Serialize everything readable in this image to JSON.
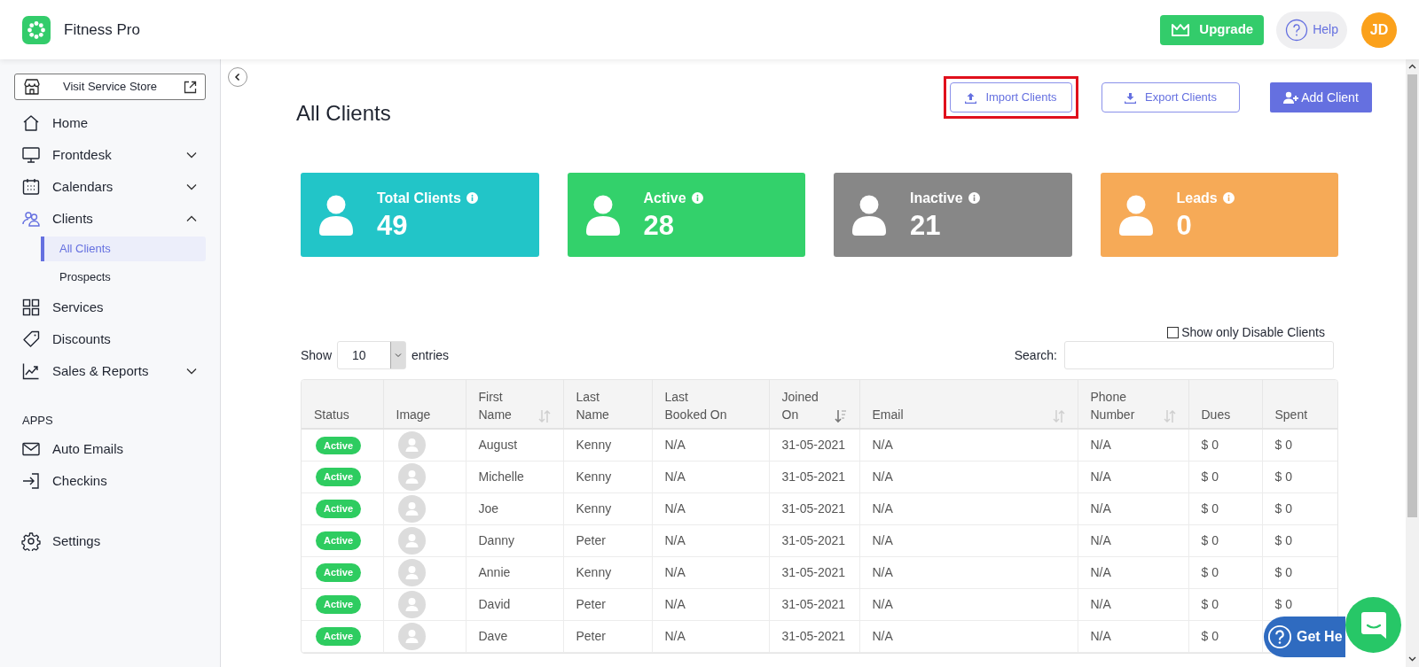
{
  "header": {
    "app_name": "Fitness Pro",
    "upgrade_label": "Upgrade",
    "help_label": "Help",
    "avatar_initials": "JD"
  },
  "sidebar": {
    "store_button": "Visit Service Store",
    "items": [
      {
        "label": "Home",
        "selected": false
      },
      {
        "label": "Frontdesk",
        "selected": false,
        "expanded": false
      },
      {
        "label": "Calendars",
        "selected": false,
        "expanded": false
      },
      {
        "label": "Clients",
        "selected": false,
        "expanded": true,
        "children": [
          {
            "label": "All Clients",
            "selected": true
          },
          {
            "label": "Prospects",
            "selected": false
          }
        ]
      },
      {
        "label": "Services",
        "selected": false
      },
      {
        "label": "Discounts",
        "selected": false
      },
      {
        "label": "Sales & Reports",
        "selected": false,
        "expanded": false
      }
    ],
    "apps_label": "APPS",
    "apps": [
      {
        "label": "Auto Emails",
        "selected": false
      },
      {
        "label": "Checkins",
        "selected": false
      }
    ],
    "footer_items": [
      {
        "label": "Settings",
        "selected": false
      }
    ]
  },
  "page": {
    "title": "All Clients",
    "buttons": [
      {
        "label": "Import Clients",
        "kind": "outline",
        "highlighted": true
      },
      {
        "label": "Export Clients",
        "kind": "outline",
        "highlighted": false
      },
      {
        "label": "Add Client",
        "kind": "primary",
        "highlighted": false
      }
    ],
    "stats": [
      {
        "label": "Total Clients",
        "value": "49",
        "color": "#22c5c8"
      },
      {
        "label": "Active",
        "value": "28",
        "color": "#33d16b"
      },
      {
        "label": "Inactive",
        "value": "21",
        "color": "#878787"
      },
      {
        "label": "Leads",
        "value": "0",
        "color": "#f6aa57"
      }
    ]
  },
  "filter": {
    "label": "Show only Disable Clients",
    "checked": false
  },
  "table_controls": {
    "show_label": "Show",
    "page_size": "10",
    "entries_label": "entries",
    "search_label": "Search:"
  },
  "table": {
    "columns": [
      {
        "label": "Status"
      },
      {
        "label": "Image"
      },
      {
        "label": "First\nName",
        "sortable": true
      },
      {
        "label": "Last\nName"
      },
      {
        "label": "Last\nBooked On"
      },
      {
        "label": "Joined\nOn",
        "sortable": true,
        "sorted_descending": true
      },
      {
        "label": "Email",
        "sortable": true
      },
      {
        "label": "Phone\nNumber",
        "sortable": true
      },
      {
        "label": "Dues"
      },
      {
        "label": "Spent"
      }
    ],
    "rows": [
      {
        "cells": [
          "Active",
          "",
          "August",
          "Kenny",
          "N/A",
          "31-05-2021",
          "N/A",
          "N/A",
          "$ 0",
          "$ 0"
        ]
      },
      {
        "cells": [
          "Active",
          "",
          "Michelle",
          "Kenny",
          "N/A",
          "31-05-2021",
          "N/A",
          "N/A",
          "$ 0",
          "$ 0"
        ]
      },
      {
        "cells": [
          "Active",
          "",
          "Joe",
          "Kenny",
          "N/A",
          "31-05-2021",
          "N/A",
          "N/A",
          "$ 0",
          "$ 0"
        ]
      },
      {
        "cells": [
          "Active",
          "",
          "Danny",
          "Peter",
          "N/A",
          "31-05-2021",
          "N/A",
          "N/A",
          "$ 0",
          "$ 0"
        ]
      },
      {
        "cells": [
          "Active",
          "",
          "Annie",
          "Kenny",
          "N/A",
          "31-05-2021",
          "N/A",
          "N/A",
          "$ 0",
          "$ 0"
        ]
      },
      {
        "cells": [
          "Active",
          "",
          "David",
          "Peter",
          "N/A",
          "31-05-2021",
          "N/A",
          "N/A",
          "$ 0",
          "$ 0"
        ]
      },
      {
        "cells": [
          "Active",
          "",
          "Dave",
          "Peter",
          "N/A",
          "31-05-2021",
          "N/A",
          "N/A",
          "$ 0"
        ]
      }
    ]
  },
  "help_widget": {
    "label": "Get He"
  }
}
